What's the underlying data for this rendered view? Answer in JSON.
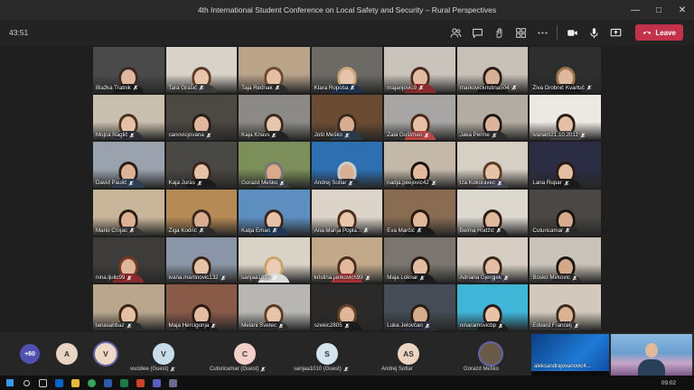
{
  "window": {
    "title": "4th International Student Conference on Local Safety and Security – Rural Perspectives"
  },
  "meeting": {
    "elapsed": "43:51",
    "leave_label": "Leave"
  },
  "grid": [
    {
      "name": "Blažka Tratnik",
      "bg": "#4a4a4a",
      "skin": "#e0b8a0",
      "hair": "#3b2a22",
      "shirt": "#1a1a1a"
    },
    {
      "name": "Tara Grašič",
      "bg": "#d9d2c8",
      "skin": "#e8c4aa",
      "hair": "#5a3a26",
      "shirt": "#3a3a3a"
    },
    {
      "name": "Taja Rednak",
      "bg": "#b9a389",
      "skin": "#e6c0a5",
      "hair": "#6b4a2f",
      "shirt": "#2a2a2a"
    },
    {
      "name": "Klara Ropoša",
      "bg": "#6d6a66",
      "skin": "#e6c3ad",
      "hair": "#c9a97a",
      "shirt": "#1e3250"
    },
    {
      "name": "majanjovic9",
      "bg": "#c9c3bb",
      "skin": "#e4bba0",
      "hair": "#4a2c1e",
      "shirt": "#8a2a2a"
    },
    {
      "name": "markovickristina504",
      "bg": "#c6c0b7",
      "skin": "#d8b096",
      "hair": "#2b1d16",
      "shirt": "#1c1c1c"
    },
    {
      "name": "Živa Drobnič Kvartuč",
      "bg": "#2e2e2e",
      "skin": "#e0b89e",
      "hair": "#a07650",
      "shirt": "#1a1a1a"
    },
    {
      "name": "Mojca Naglič",
      "bg": "#c9bfae",
      "skin": "#e6c1a4",
      "hair": "#4a3122",
      "shirt": "#2e2e3a"
    },
    {
      "name": "canovicjovana",
      "bg": "#4c4842",
      "skin": "#e0b79c",
      "hair": "#2a1c16",
      "shirt": "#303030"
    },
    {
      "name": "Kaja Knavs",
      "bg": "#8c8a87",
      "skin": "#e8c6ae",
      "hair": "#3a281e",
      "shirt": "#222"
    },
    {
      "name": "Jošt Meško",
      "bg": "#6b4c32",
      "skin": "#d9ae90",
      "hair": "#3a2a1e",
      "shirt": "#2a3a4a"
    },
    {
      "name": "Zala Guštman",
      "bg": "#a8a6a4",
      "skin": "#e6c0a6",
      "hair": "#4a2a1a",
      "shirt": "#b44"
    },
    {
      "name": "Jaka Perme",
      "bg": "#b3aca2",
      "skin": "#dcb49a",
      "hair": "#1e1612",
      "shirt": "#2a2a2a"
    },
    {
      "name": "ivanam21.10.2011",
      "bg": "#ece8e2",
      "skin": "#e4c0a8",
      "hair": "#2a1e16",
      "shirt": "#444"
    },
    {
      "name": "David Paulič",
      "bg": "#9aa3ad",
      "skin": "#dcb296",
      "hair": "#2a1c12",
      "shirt": "#2d3e52"
    },
    {
      "name": "Kaja Juras",
      "bg": "#4a4844",
      "skin": "#e6c3a8",
      "hair": "#3a2418",
      "shirt": "#1a1a1a"
    },
    {
      "name": "Gorazd Meško",
      "bg": "#7c8f5a",
      "skin": "#d9a98a",
      "hair": "#777",
      "shirt": "#3a3f48"
    },
    {
      "name": "Andrej Sotlar",
      "bg": "#2d6fb1",
      "skin": "#d9ae92",
      "hair": "#ccc",
      "shirt": "#2a2f3a"
    },
    {
      "name": "nadja.peejovic42",
      "bg": "#c4b9a9",
      "skin": "#e3b99c",
      "hair": "#1a120e",
      "shirt": "#222"
    },
    {
      "name": "Iza Kokoravec",
      "bg": "#d6cfc4",
      "skin": "#e6c2a6",
      "hair": "#5a3a22",
      "shirt": "#445"
    },
    {
      "name": "Lana Rupar",
      "bg": "#2b2d44",
      "skin": "#e4bea2",
      "hair": "#2a1a12",
      "shirt": "#1a1a1a"
    },
    {
      "name": "Mario Crnjac",
      "bg": "#c9b69a",
      "skin": "#dcb092",
      "hair": "#2a1c12",
      "shirt": "#333"
    },
    {
      "name": "Žiga Kodrič",
      "bg": "#b58a55",
      "skin": "#d9ae90",
      "hair": "#3a2a1c",
      "shirt": "#2a2a2a"
    },
    {
      "name": "Katja Eman",
      "bg": "#5c8ec0",
      "skin": "#e6c3a8",
      "hair": "#3a2418",
      "shirt": "#1f3552"
    },
    {
      "name": "Ana Marija Popla...",
      "bg": "#dcd4c8",
      "skin": "#e8c4aa",
      "hair": "#4a2c1c",
      "shirt": "#2a2a2a"
    },
    {
      "name": "Eva Marčič",
      "bg": "#8a6c52",
      "skin": "#e0b89c",
      "hair": "#2a1a12",
      "shirt": "#1a1a1a"
    },
    {
      "name": "Belma Hodžić",
      "bg": "#dcd7cf",
      "skin": "#e2b89c",
      "hair": "#2a1c14",
      "shirt": "#222"
    },
    {
      "name": "Cuturicamar",
      "bg": "#4a4744",
      "skin": "#d6aa8c",
      "hair": "#1a1410",
      "shirt": "#2a2a2a"
    },
    {
      "name": "nina.ljulic99",
      "bg": "#3e3c3a",
      "skin": "#e0b69a",
      "hair": "#7a3a22",
      "shirt": "#8a2a2a"
    },
    {
      "name": "ivana.martinovic132",
      "bg": "#8a96a8",
      "skin": "#e6c2a6",
      "hair": "#3a2418",
      "shirt": "#333"
    },
    {
      "name": "sanjaa1010",
      "bg": "#d9d2c6",
      "skin": "#ecccb4",
      "hair": "#c9a46a",
      "shirt": "#ddd"
    },
    {
      "name": "kristina.jankovich99",
      "bg": "#c2a98a",
      "skin": "#e2b89c",
      "hair": "#4a2a1a",
      "shirt": "#a33"
    },
    {
      "name": "Maja Loknar",
      "bg": "#7a756e",
      "skin": "#e2bca2",
      "hair": "#2a1a12",
      "shirt": "#1a1a1a"
    },
    {
      "name": "Adriana Gjergjek",
      "bg": "#d6cec2",
      "skin": "#e4bea4",
      "hair": "#3a2418",
      "shirt": "#3a3a4a"
    },
    {
      "name": "Bosko Mirkovic",
      "bg": "#c8c2b8",
      "skin": "#d4a888",
      "hair": "#1a1410",
      "shirt": "#2a2a2a"
    },
    {
      "name": "lanasahbaz",
      "bg": "#b9a68c",
      "skin": "#e6c0a4",
      "hair": "#3a2418",
      "shirt": "#2a2a2a"
    },
    {
      "name": "Maja Hercigonja",
      "bg": "#8a5a48",
      "skin": "#e4bca0",
      "hair": "#2a1a12",
      "shirt": "#1a1a1a"
    },
    {
      "name": "Melani Svetec",
      "bg": "#b8b6b2",
      "skin": "#e6c4aa",
      "hair": "#5a3a22",
      "shirt": "#2a2a2a"
    },
    {
      "name": "szekic2805",
      "bg": "#2c2a28",
      "skin": "#e0b69a",
      "hair": "#6a4228",
      "shirt": "#1a1a1a"
    },
    {
      "name": "Luka Jelovčan",
      "bg": "#454c56",
      "skin": "#d6ac8e",
      "hair": "#2a1c14",
      "shirt": "#2d2d3a"
    },
    {
      "name": "ninaramovicbp",
      "bg": "#3fb5d8",
      "skin": "#e6c2a6",
      "hair": "#2a1a12",
      "shirt": "#1a1a1a"
    },
    {
      "name": "Edvard Francelj",
      "bg": "#d2c9bc",
      "skin": "#dcb294",
      "hair": "#3a2a1c",
      "shirt": "#333"
    }
  ],
  "strip": {
    "more_label": "+60",
    "participants": [
      {
        "initial": "A",
        "name": "",
        "color": "#e8d5c4"
      },
      {
        "initial": "V",
        "name": "",
        "color": "#f0d8c8"
      },
      {
        "initial": "V",
        "name": "vucidee (Guest)",
        "color": "#c8dcea"
      },
      {
        "initial": "C",
        "name": "Cuturicamar (Guest)",
        "color": "#f2cfc8"
      },
      {
        "initial": "S",
        "name": "sanjaa1010 (Guest)",
        "color": "#d4e4ee"
      },
      {
        "initial": "AS",
        "name": "Andrej Sotlar",
        "color": "#ecd4c2"
      },
      {
        "initial": "",
        "name": "Gorazd Meško",
        "color": "#6a5a48"
      }
    ],
    "screen_share_name": "aleksandrajovanovic4..."
  },
  "taskbar": {
    "time": "09:02"
  }
}
